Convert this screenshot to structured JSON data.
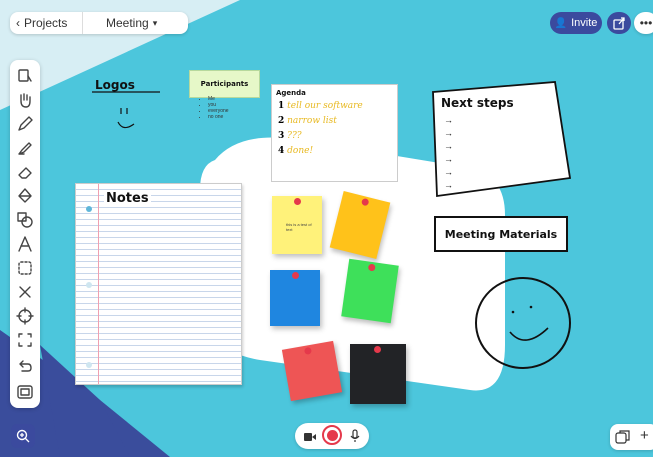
{
  "topbar": {
    "projects_label": "Projects",
    "meeting_label": "Meeting",
    "invite_label": "Invite"
  },
  "toolbar": {
    "tools": [
      "select",
      "hand",
      "pen",
      "highlighter",
      "eraser",
      "fill",
      "shapes",
      "text",
      "lasso",
      "connector",
      "target",
      "frame",
      "undo",
      "minimap"
    ]
  },
  "board": {
    "logos_title": "Logos",
    "logos_doodle": "′′\n\\_/",
    "participants": {
      "title": "Participants",
      "items": [
        "Me",
        "you",
        "everyone",
        "no one"
      ]
    },
    "agenda": {
      "title": "Agenda",
      "items": [
        {
          "num": "1",
          "text": "tell our software"
        },
        {
          "num": "2",
          "text": "narrow list"
        },
        {
          "num": "3",
          "text": "???"
        },
        {
          "num": "4",
          "text": "done!"
        }
      ]
    },
    "next_steps": {
      "title": "Next steps",
      "arrows": [
        "→",
        "→",
        "→",
        "→",
        "→",
        "→"
      ]
    },
    "notes_title": "Notes",
    "meeting_materials": "Meeting Materials",
    "sticky_text": "this is a test of text"
  },
  "colors": {
    "canvas_teal": "#4cc6dc",
    "accent_blue": "#3b4a9e",
    "sticky_yellow": "#fff27a",
    "sticky_orange": "#ffc21a",
    "sticky_blue": "#1f86e0",
    "sticky_green": "#3ee05a",
    "sticky_red": "#ee5555",
    "sticky_black": "#222326",
    "agenda_text": "#e8b921",
    "record_red": "#e5394b"
  },
  "bottombar": {
    "zoom_icon": "zoom-icon",
    "video_icon": "video-icon",
    "record_icon": "record-icon",
    "mic_icon": "mic-icon",
    "pages_icon": "pages-icon",
    "add_label": "+"
  }
}
